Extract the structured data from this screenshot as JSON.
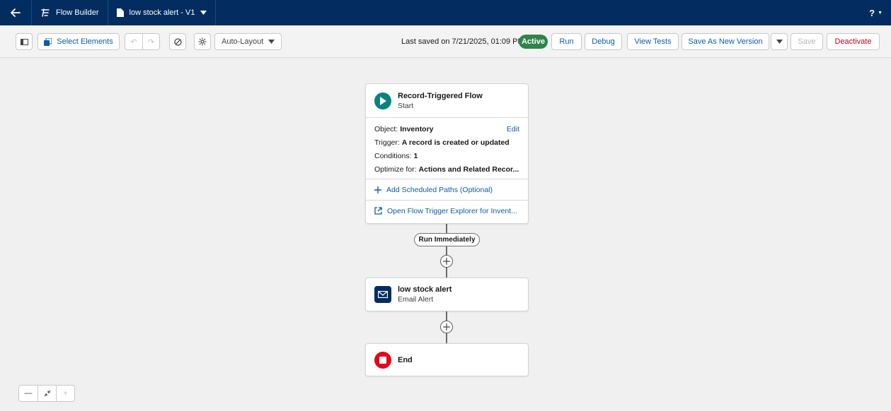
{
  "header": {
    "app_name": "Flow Builder",
    "flow_tab": "low stock alert - V1",
    "help": "?"
  },
  "toolbar": {
    "select_elements": "Select Elements",
    "layout_mode": "Auto-Layout",
    "last_saved": "Last saved on 7/21/2025, 01:09 PM",
    "status": "Active",
    "run": "Run",
    "debug": "Debug",
    "view_tests": "View Tests",
    "save_as_new_version": "Save As New Version",
    "save": "Save",
    "deactivate": "Deactivate"
  },
  "start_node": {
    "title": "Record-Triggered Flow",
    "subtitle": "Start",
    "object_label": "Object:",
    "object_value": "Inventory",
    "edit": "Edit",
    "trigger_label": "Trigger:",
    "trigger_value": "A record is created or updated",
    "conditions_label": "Conditions:",
    "conditions_value": "1",
    "optimize_label": "Optimize for:",
    "optimize_value": "Actions and Related Recor...",
    "add_paths": "Add Scheduled Paths (Optional)",
    "open_explorer": "Open Flow Trigger Explorer for Invent..."
  },
  "path_label": "Run Immediately",
  "action_node": {
    "title": "low stock alert",
    "subtitle": "Email Alert"
  },
  "end_node": {
    "title": "End"
  },
  "colors": {
    "header_bg": "#032d60",
    "brand_blue": "#0b5cab",
    "active_green": "#2e844a",
    "start_teal": "#0b827c",
    "end_red": "#e3061d",
    "deactivate_red": "#ba0517"
  }
}
